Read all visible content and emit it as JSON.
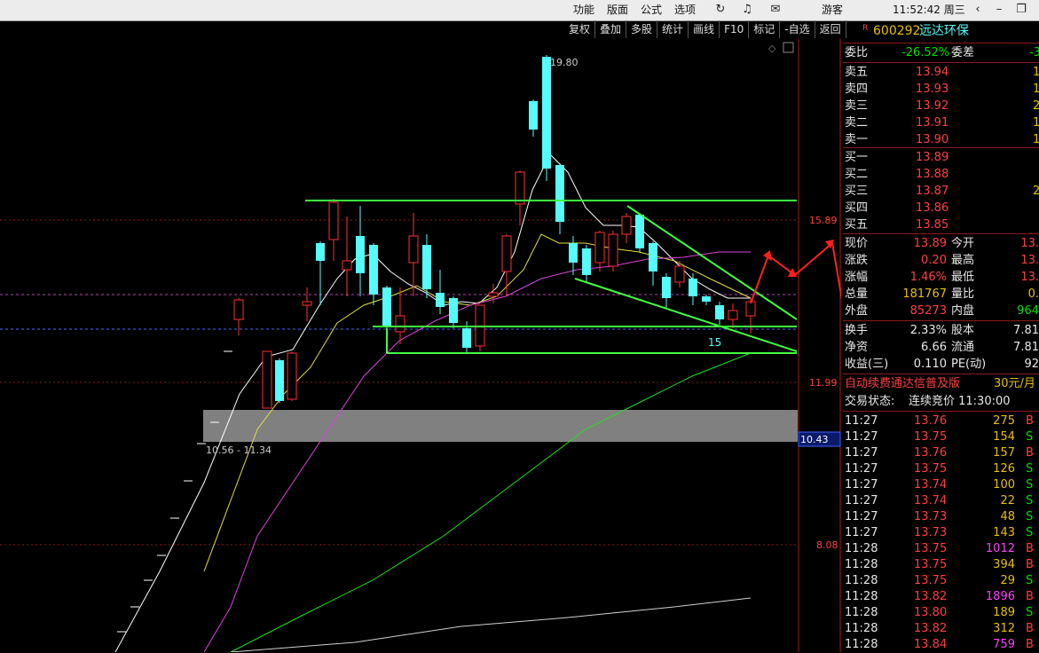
{
  "topbar": {
    "menus": [
      "功能",
      "版面",
      "公式",
      "选项"
    ],
    "user": "游客",
    "clock": "11:52:42 周三"
  },
  "toolbar": [
    "复权",
    "叠加",
    "多股",
    "统计",
    "画线",
    "F10",
    "标记",
    "-自选",
    "返回"
  ],
  "chart_data": {
    "type": "candlestick",
    "price_labels": [
      "15.89",
      "11.99",
      "8.08"
    ],
    "current_price_tag": "10.43",
    "high_marker": "19.80",
    "range_label": "10.56 - 11.34",
    "annotation": "15"
  },
  "stock": {
    "badge": "R",
    "code": "600292",
    "name": "远达环保"
  },
  "weibi": {
    "label1": "委比",
    "value1": "-26.52%",
    "label2": "委差",
    "value2": "-3"
  },
  "sell_orders": [
    {
      "label": "卖五",
      "price": "13.94",
      "vol": "1"
    },
    {
      "label": "卖四",
      "price": "13.93",
      "vol": "1"
    },
    {
      "label": "卖三",
      "price": "13.92",
      "vol": "2"
    },
    {
      "label": "卖二",
      "price": "13.91",
      "vol": "1"
    },
    {
      "label": "卖一",
      "price": "13.90",
      "vol": "1"
    }
  ],
  "buy_orders": [
    {
      "label": "买一",
      "price": "13.89",
      "vol": ""
    },
    {
      "label": "买二",
      "price": "13.88",
      "vol": ""
    },
    {
      "label": "买三",
      "price": "13.87",
      "vol": "2"
    },
    {
      "label": "买四",
      "price": "13.86",
      "vol": ""
    },
    {
      "label": "买五",
      "price": "13.85",
      "vol": ""
    }
  ],
  "quote": [
    {
      "l1": "现价",
      "v1": "13.89",
      "l2": "今开",
      "v2": "13."
    },
    {
      "l1": "涨跌",
      "v1": "0.20",
      "l2": "最高",
      "v2": "13."
    },
    {
      "l1": "涨幅",
      "v1": "1.46%",
      "l2": "最低",
      "v2": "13."
    },
    {
      "l1": "总量",
      "v1": "181767",
      "l2": "量比",
      "v2": "0."
    },
    {
      "l1": "外盘",
      "v1": "85273",
      "l2": "内盘",
      "v2": "964"
    }
  ],
  "quote2": [
    {
      "l1": "换手",
      "v1": "2.33%",
      "l2": "股本",
      "v2": "7.81"
    },
    {
      "l1": "净资",
      "v1": "6.66",
      "l2": "流通",
      "v2": "7.81"
    },
    {
      "l1": "收益(三)",
      "v1": "0.110",
      "l2": "PE(动)",
      "v2": "92"
    }
  ],
  "promo": {
    "text": "自动续费通达信普及版",
    "price": "30元/月"
  },
  "trade_status": {
    "label": "交易状态:",
    "value": "连续竞价 11:30:00"
  },
  "ticks": [
    {
      "t": "11:27",
      "p": "13.76",
      "v": "275",
      "s": "B"
    },
    {
      "t": "11:27",
      "p": "13.75",
      "v": "154",
      "s": "S"
    },
    {
      "t": "11:27",
      "p": "13.76",
      "v": "157",
      "s": "B"
    },
    {
      "t": "11:27",
      "p": "13.75",
      "v": "126",
      "s": "S"
    },
    {
      "t": "11:27",
      "p": "13.74",
      "v": "100",
      "s": "S"
    },
    {
      "t": "11:27",
      "p": "13.74",
      "v": "22",
      "s": "S"
    },
    {
      "t": "11:27",
      "p": "13.73",
      "v": "48",
      "s": "S"
    },
    {
      "t": "11:27",
      "p": "13.73",
      "v": "143",
      "s": "S"
    },
    {
      "t": "11:28",
      "p": "13.75",
      "v": "1012",
      "s": "B"
    },
    {
      "t": "11:28",
      "p": "13.75",
      "v": "394",
      "s": "B"
    },
    {
      "t": "11:28",
      "p": "13.75",
      "v": "29",
      "s": "S"
    },
    {
      "t": "11:28",
      "p": "13.82",
      "v": "1896",
      "s": "B"
    },
    {
      "t": "11:28",
      "p": "13.80",
      "v": "189",
      "s": "S"
    },
    {
      "t": "11:28",
      "p": "13.82",
      "v": "312",
      "s": "B"
    },
    {
      "t": "11:28",
      "p": "13.84",
      "v": "759",
      "s": "B"
    }
  ]
}
